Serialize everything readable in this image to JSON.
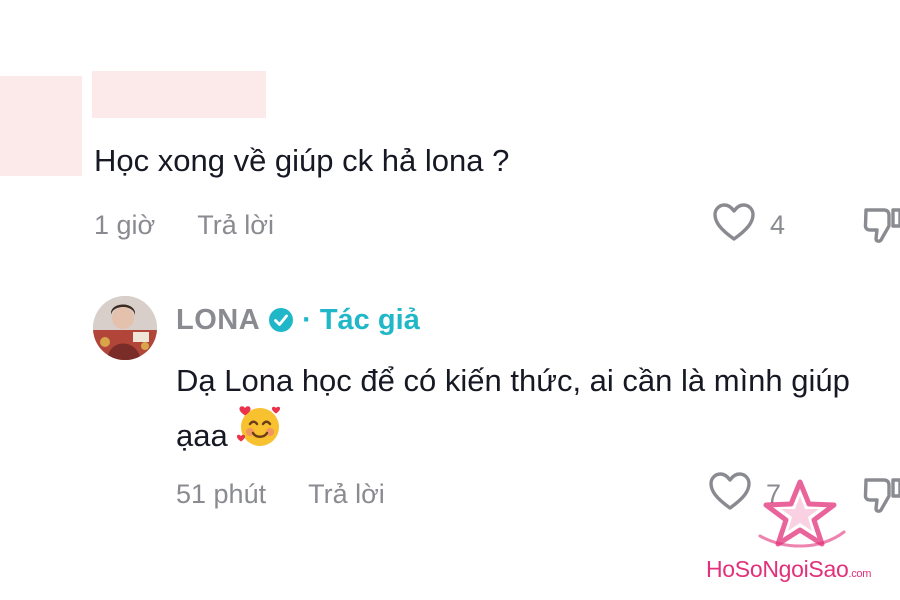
{
  "comment": {
    "text": "Học xong về giúp ck hả lona ?",
    "time": "1 giờ",
    "reply_label": "Trả lời",
    "like_count": "4"
  },
  "reply": {
    "author": "LONA",
    "separator": "·",
    "author_tag": "Tác giả",
    "text": "Dạ Lona học để có kiến thức, ai cần là mình giúp ạaa",
    "emoji": "smiling-face-with-hearts",
    "time": "51 phút",
    "reply_label": "Trả lời",
    "like_count": "7"
  },
  "watermark": {
    "text": "HoSoNgoiSao",
    "domain": ".com"
  },
  "colors": {
    "text": "#161823",
    "muted": "#8a8b91",
    "author_tag": "#20b8c8",
    "verified": "#20b8c8",
    "redaction": "#fce9e9",
    "watermark": "#e2307a"
  }
}
